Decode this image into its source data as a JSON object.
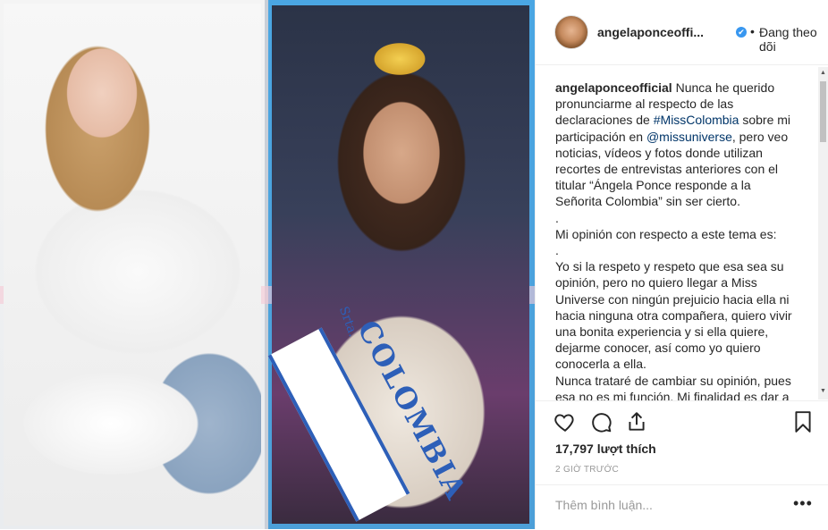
{
  "media": {
    "sash_small": "Srta.",
    "sash_big": "COLOMBIA"
  },
  "header": {
    "username": "angelaponceoffi...",
    "verified_icon": "✔",
    "dot": "•",
    "follow_label": "Đang theo dõi"
  },
  "caption": {
    "username": "angelaponceofficial",
    "part1": " Nunca he querido pronunciarme al respecto de las declaraciones de ",
    "hashtag": "#MissColombia",
    "part2": " sobre mi participación en ",
    "mention": "@missuniverse",
    "part3": ", pero veo noticias, vídeos y fotos donde utilizan recortes de entrevistas anteriores con el titular “Ángela Ponce responde a la Señorita Colombia” sin ser cierto.\n.\nMi opinión con respecto a este tema es:\n.\nYo si la respeto y respeto que esa sea su opinión, pero no quiero llegar a Miss Universe con ningún prejuicio hacia ella ni hacia ninguna otra compañera, quiero vivir una bonita experiencia y si ella quiere, dejarme conocer, así como yo quiero conocerla a ella.\nNunca trataré de cambiar su opinión, pues esa no es mi función. Mi finalidad es dar a"
  },
  "actions": {
    "icons": [
      "heart-icon",
      "comment-icon",
      "share-icon",
      "bookmark-icon"
    ]
  },
  "likes": "17,797 lượt thích",
  "timestamp": "2 GIỜ TRƯỚC",
  "comment": {
    "placeholder": "Thêm bình luận...",
    "more_label": "•••"
  },
  "scrollbar": {
    "up": "▲",
    "down": "▼"
  },
  "colors": {
    "link": "#003569",
    "verified": "#3897f0",
    "frame_blue": "#4aa6e3",
    "frame_pink": "#f6c8d6"
  }
}
